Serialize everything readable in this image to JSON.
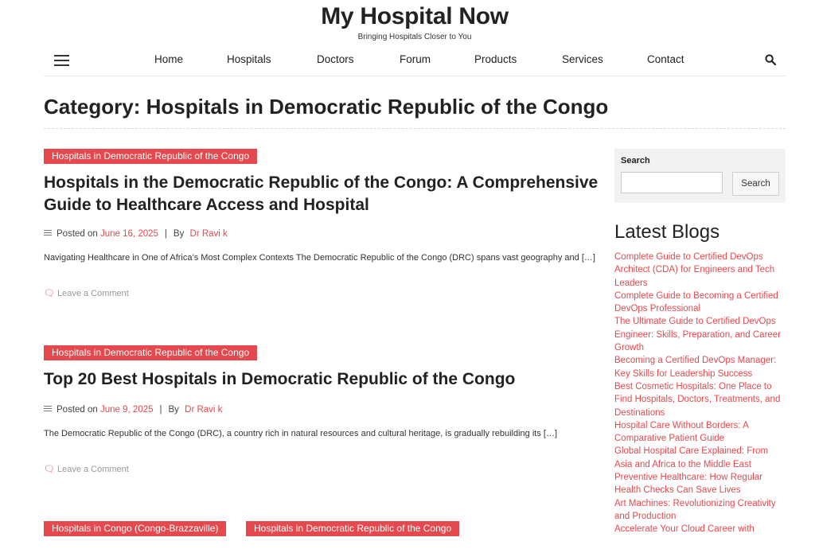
{
  "site": {
    "title": "My Hospital Now",
    "tagline": "Bringing Hospitals Closer to You"
  },
  "nav": {
    "items": [
      "Home",
      "Hospitals",
      "Doctors",
      "Forum",
      "Products",
      "Services",
      "Contact"
    ],
    "menu_icon": "hamburger-menu-icon",
    "search_icon": "search-icon"
  },
  "category": {
    "title": "Category: Hospitals in Democratic Republic of the Congo"
  },
  "posts": [
    {
      "categories": [
        "Hospitals in Democratic Republic of the Congo"
      ],
      "title": "Hospitals in the Democratic Republic of the Congo: A Comprehensive Guide to Healthcare Access and Hospital",
      "posted_on_label": "Posted on",
      "date": "June 16, 2025",
      "by_label": "By",
      "author": "Dr Ravi k",
      "excerpt": "Navigating Healthcare in One of Africa’s Most Complex Contexts The Democratic Republic of the Congo (DRC) spans vast geography and […]",
      "comment_label": "Leave a Comment"
    },
    {
      "categories": [
        "Hospitals in Democratic Republic of the Congo"
      ],
      "title": "Top 20 Best Hospitals in Democratic Republic of the Congo",
      "posted_on_label": "Posted on",
      "date": "June 9, 2025",
      "by_label": "By",
      "author": "Dr Ravi k",
      "excerpt": "The Democratic Republic of the Congo (DRC), a country rich in natural resources and cultural heritage, is gradually rebuilding its […]",
      "comment_label": "Leave a Comment"
    },
    {
      "categories": [
        "Hospitals in Congo (Congo-Brazzaville)",
        "Hospitals in Democratic Republic of the Congo"
      ]
    }
  ],
  "sidebar": {
    "search_label": "Search",
    "search_value": "",
    "search_button": "Search",
    "latest_title": "Latest Blogs",
    "latest_items": [
      "Complete Guide to Certified DevOps Architect (CDA) for Engineers and Tech Leaders",
      "Complete Guide to Becoming a Certified DevOps Professional",
      "The Ultimate Guide to Certified DevOps Engineer: Skills, Preparation, and Career Growth",
      "Becoming a Certified DevOps Manager: Key Skills for Leadership Success",
      "Best Cosmetic Hospitals: One Place to Find Hospitals, Doctors, Treatments, and Destinations",
      "Hospital Care Without Borders: A Comparative Patient Guide",
      "Global Hospital Care Explained: From Asia and Africa to the Middle East",
      "Preventive Healthcare: How Regular Health Checks Can Save Lives",
      "Art Machines: Revolutionizing Creativity and Production",
      "Accelerate Your Cloud Career with"
    ]
  },
  "colors": {
    "accent": "#e5484d",
    "text": "#222222",
    "sidebar_bg": "#f2f2f2"
  }
}
